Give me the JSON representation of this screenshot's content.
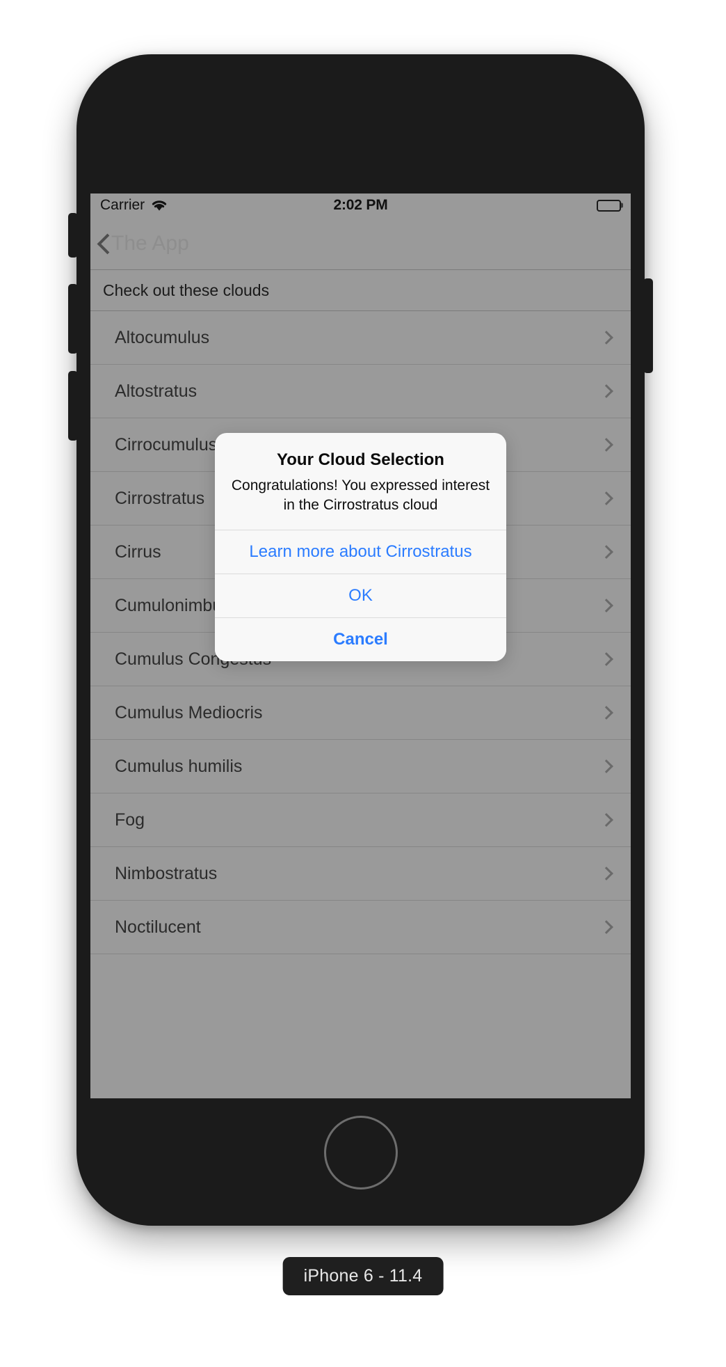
{
  "simulator": {
    "device_label": "iPhone 6 - 11.4"
  },
  "status_bar": {
    "carrier": "Carrier",
    "wifi_icon": "wifi-icon",
    "time": "2:02 PM",
    "battery_icon": "battery-icon"
  },
  "nav_bar": {
    "back_icon": "chevron-left-icon",
    "back_label": "The App"
  },
  "table": {
    "header": "Check out these clouds",
    "disclosure_icon": "chevron-right-icon",
    "rows": [
      {
        "label": "Altocumulus"
      },
      {
        "label": "Altostratus"
      },
      {
        "label": "Cirrocumulus"
      },
      {
        "label": "Cirrostratus"
      },
      {
        "label": "Cirrus"
      },
      {
        "label": "Cumulonimbus"
      },
      {
        "label": "Cumulus Congestus"
      },
      {
        "label": "Cumulus Mediocris"
      },
      {
        "label": "Cumulus humilis"
      },
      {
        "label": "Fog"
      },
      {
        "label": "Nimbostratus"
      },
      {
        "label": "Noctilucent"
      }
    ]
  },
  "alert": {
    "title": "Your Cloud Selection",
    "message": "Congratulations! You expressed interest in the Cirrostratus cloud",
    "buttons": [
      {
        "label": "Learn more about Cirrostratus",
        "style": "default"
      },
      {
        "label": "OK",
        "style": "default"
      },
      {
        "label": "Cancel",
        "style": "cancel"
      }
    ],
    "tint_color": "#2b7cff"
  }
}
